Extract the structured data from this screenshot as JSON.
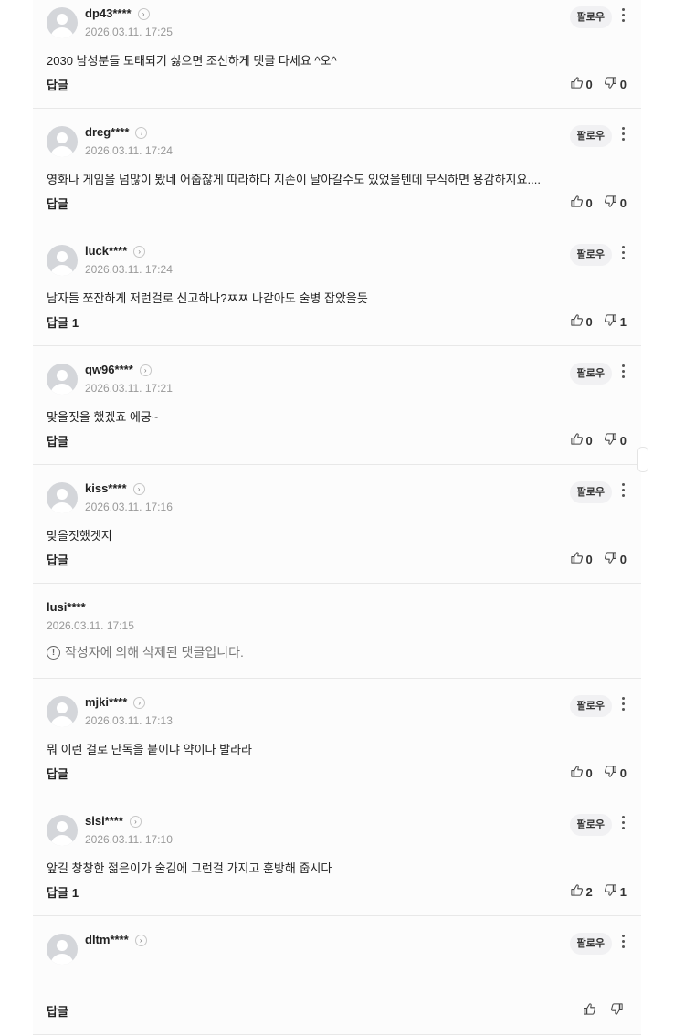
{
  "ui": {
    "follow_label": "팔로우",
    "reply_label": "답글",
    "deleted_message": "작성자에 의해 삭제된 댓글입니다."
  },
  "comments": [
    {
      "nick": "dp43****",
      "date": "2026.03.11. 17:25",
      "text": "2030 남성분들 도태되기 싫으면 조신하게 댓글 다세요 ^오^",
      "reply_count": "",
      "likes": "0",
      "dislikes": "0"
    },
    {
      "nick": "dreg****",
      "date": "2026.03.11. 17:24",
      "text": "영화나 게임을 넘많이 봤네 어줍잖게 따라하다 지손이 날아갈수도 있었을텐데 무식하면 용감하지요....",
      "reply_count": "",
      "likes": "0",
      "dislikes": "0"
    },
    {
      "nick": "luck****",
      "date": "2026.03.11. 17:24",
      "text": "남자들 쪼잔하게 저런걸로 신고하나?ㅉㅉ 나같아도 술병 잡았을듯",
      "reply_count": "1",
      "likes": "0",
      "dislikes": "1"
    },
    {
      "nick": "qw96****",
      "date": "2026.03.11. 17:21",
      "text": "맞을짓을 했겠죠 에궁~",
      "reply_count": "",
      "likes": "0",
      "dislikes": "0"
    },
    {
      "nick": "kiss****",
      "date": "2026.03.11. 17:16",
      "text": "맞을짓했겟지",
      "reply_count": "",
      "likes": "0",
      "dislikes": "0"
    }
  ],
  "deleted_comment": {
    "nick": "lusi****",
    "date": "2026.03.11. 17:15"
  },
  "comments_after": [
    {
      "nick": "mjki****",
      "date": "2026.03.11. 17:13",
      "text": "뭐 이런 걸로 단독을 붙이냐 약이나 발라라",
      "reply_count": "",
      "likes": "0",
      "dislikes": "0"
    },
    {
      "nick": "sisi****",
      "date": "2026.03.11. 17:10",
      "text": "앞길 창창한 젊은이가 술김에 그런걸 가지고 훈방해 줍시다",
      "reply_count": "1",
      "likes": "2",
      "dislikes": "1"
    },
    {
      "nick": "dltm****",
      "date": "",
      "text": "",
      "reply_count": "",
      "likes": "",
      "dislikes": ""
    }
  ]
}
